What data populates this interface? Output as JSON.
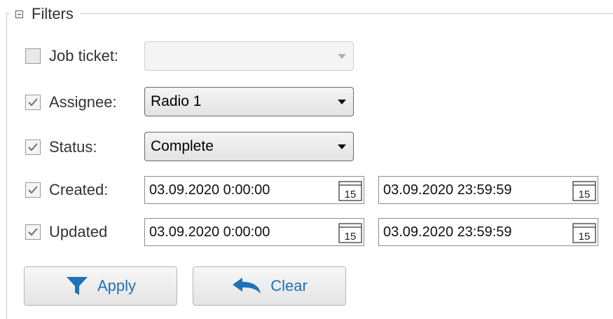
{
  "filters": {
    "title": "Filters",
    "job_ticket": {
      "label": "Job ticket:",
      "checked": false,
      "value": "",
      "enabled": false
    },
    "assignee": {
      "label": "Assignee:",
      "checked": true,
      "value": "Radio 1"
    },
    "status": {
      "label": "Status:",
      "checked": true,
      "value": "Complete"
    },
    "created": {
      "label": "Created:",
      "checked": true,
      "from": "03.09.2020 0:00:00",
      "to": "03.09.2020 23:59:59"
    },
    "updated": {
      "label": "Updated",
      "checked": true,
      "from": "03.09.2020 0:00:00",
      "to": "03.09.2020 23:59:59"
    },
    "calendar_day": "15",
    "apply_label": "Apply",
    "clear_label": "Clear"
  },
  "colors": {
    "accent": "#1e72b8",
    "border": "#8c8c8c",
    "groupbox": "#c9c9c9"
  },
  "icons": {
    "collapse": "minus-box-icon",
    "checkbox": "checkmark-icon",
    "dropdown": "chevron-down-icon",
    "calendar": "calendar-icon",
    "apply": "funnel-icon",
    "clear": "undo-arrow-icon"
  }
}
